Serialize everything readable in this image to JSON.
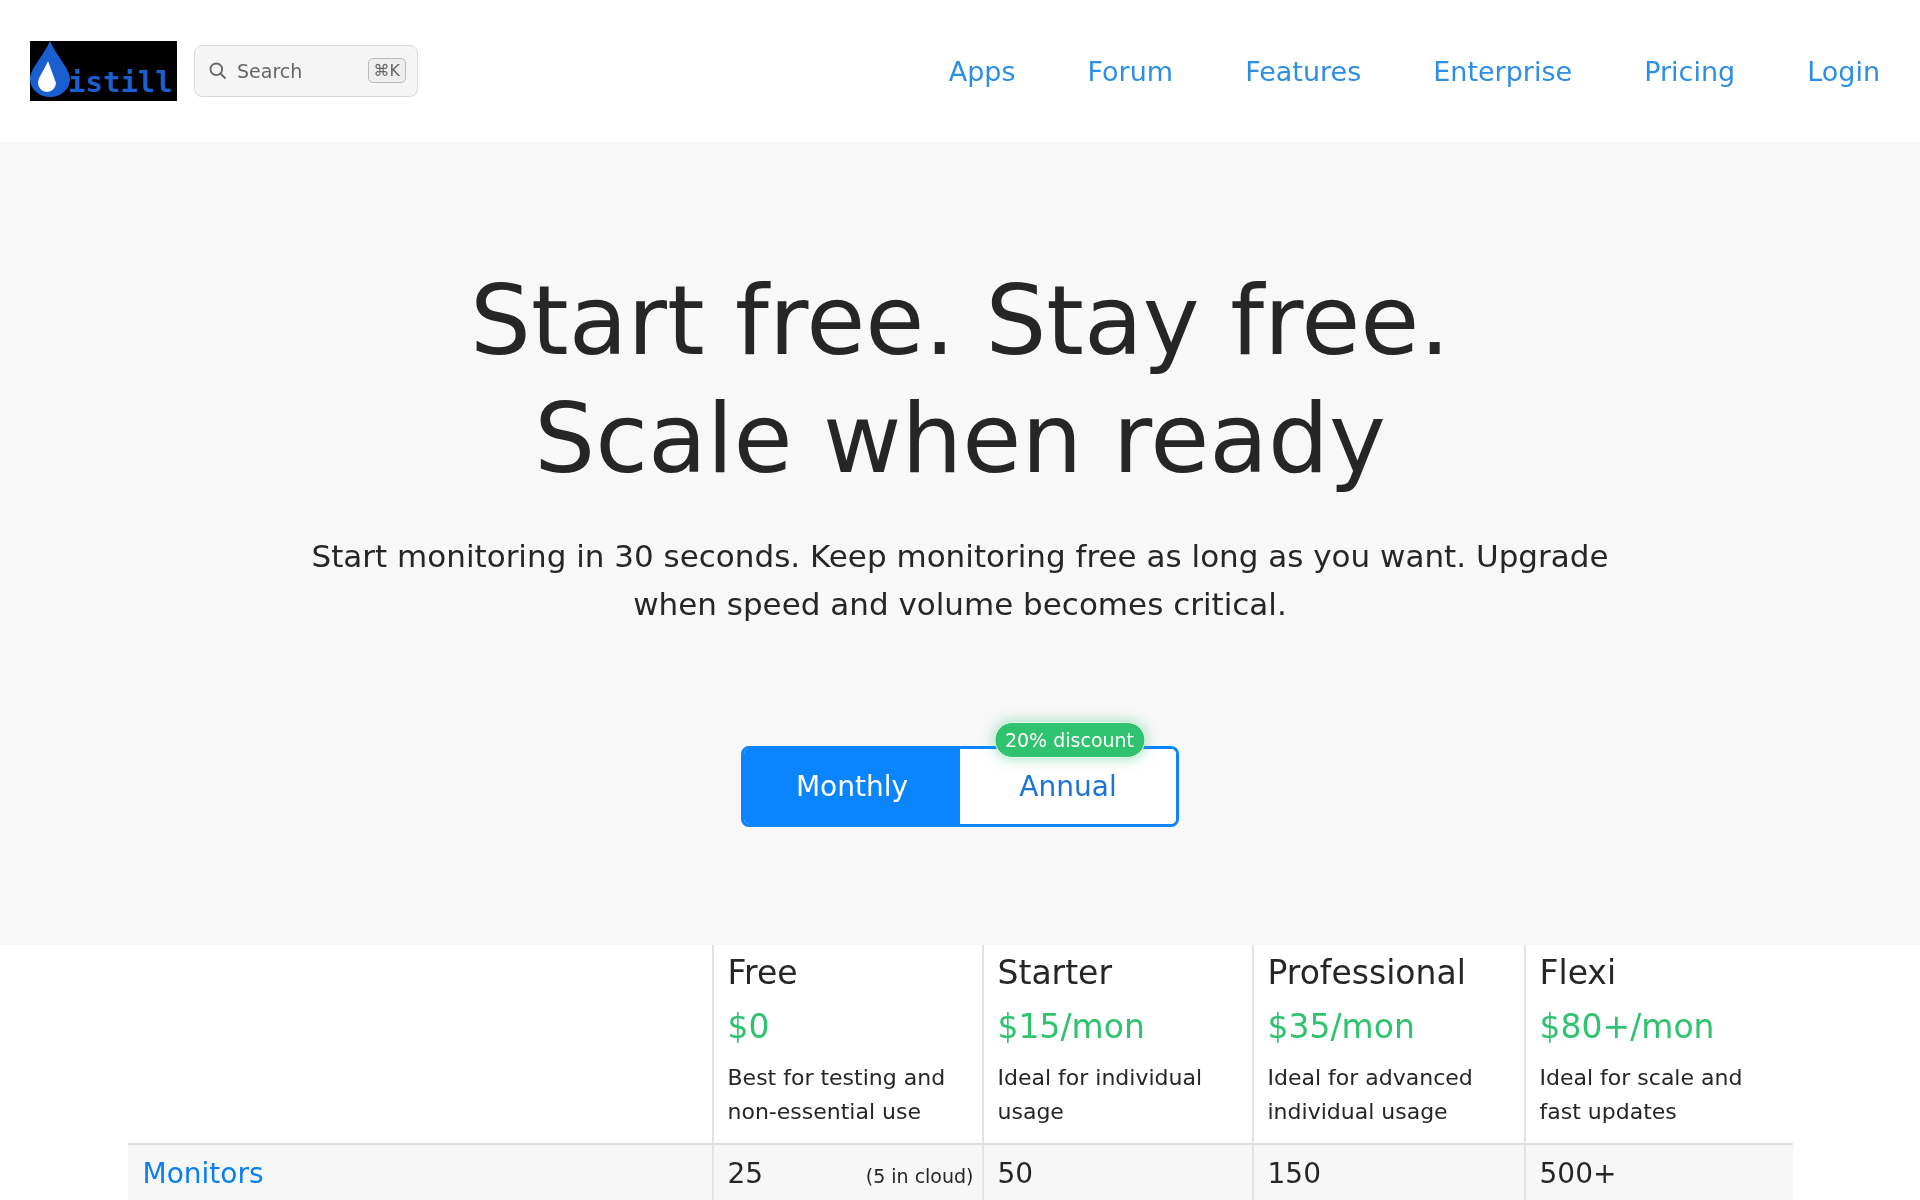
{
  "header": {
    "logo": {
      "text": "istill"
    },
    "search": {
      "placeholder": "Search",
      "shortcut": "⌘K"
    },
    "nav": [
      {
        "label": "Apps"
      },
      {
        "label": "Forum"
      },
      {
        "label": "Features"
      },
      {
        "label": "Enterprise"
      },
      {
        "label": "Pricing"
      },
      {
        "label": "Login"
      }
    ]
  },
  "hero": {
    "title_lines": [
      "Start free. Stay free.",
      "Scale when ready"
    ],
    "subtitle": "Start monitoring in 30 seconds. Keep monitoring free as long as you want. Upgrade when speed and volume becomes critical."
  },
  "billing_toggle": {
    "options": [
      {
        "label": "Monthly",
        "selected": true
      },
      {
        "label": "Annual",
        "selected": false,
        "badge": "20% discount"
      }
    ]
  },
  "plans_table": {
    "plans": [
      {
        "name": "Free",
        "price": "$0",
        "description": "Best for testing and non-essential use"
      },
      {
        "name": "Starter",
        "price": "$15/mon",
        "description": "Ideal for individual usage"
      },
      {
        "name": "Professional",
        "price": "$35/mon",
        "description": "Ideal for advanced individual usage"
      },
      {
        "name": "Flexi",
        "price": "$80+/mon",
        "description": "Ideal for scale and fast updates"
      }
    ],
    "rows": [
      {
        "label": "Monitors",
        "cells": [
          {
            "value": "25",
            "note": "(5 in cloud)"
          },
          {
            "value": "50"
          },
          {
            "value": "150"
          },
          {
            "value": "500+"
          }
        ]
      }
    ]
  }
}
